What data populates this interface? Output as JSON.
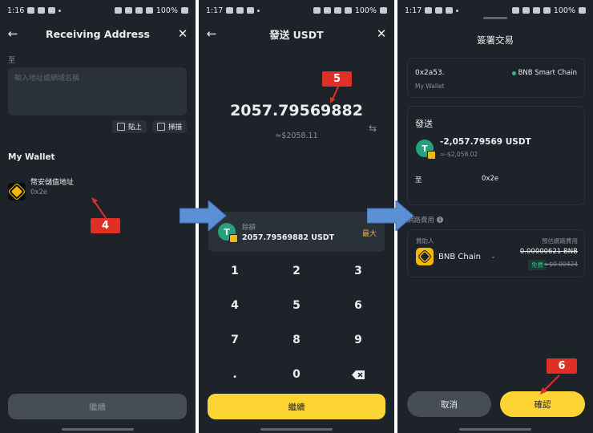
{
  "panel1": {
    "status": {
      "time": "1:16",
      "battery": "100%"
    },
    "title": "Receiving Address",
    "to_label": "至",
    "address_placeholder": "輸入地址或網域名稱",
    "paste_label": "貼上",
    "scan_label": "掃描",
    "wallet_section": "My Wallet",
    "wallet_item": {
      "name": "幣安儲值地址",
      "address": "0x2e"
    },
    "continue_label": "繼續",
    "step_label": "4"
  },
  "panel2": {
    "status": {
      "time": "1:17",
      "battery": "100%"
    },
    "title": "發送 USDT",
    "amount": "2057.79569882",
    "fiat": "≈$2058.11",
    "balance_label": "餘額",
    "balance_value": "2057.79569882 USDT",
    "max_label": "最大",
    "keys": [
      "1",
      "2",
      "3",
      "4",
      "5",
      "6",
      "7",
      "8",
      "9",
      ".",
      "0"
    ],
    "continue_label": "繼續",
    "step_label": "5"
  },
  "panel3": {
    "status": {
      "time": "1:17",
      "battery": "100%"
    },
    "title": "簽署交易",
    "from_address": "0x2a53.",
    "from_wallet": "My Wallet",
    "chain_tag": "BNB Smart Chain",
    "send_label": "發送",
    "send_amount": "-2,057.79569 USDT",
    "send_fiat": "≈-$2,058.02",
    "to_label": "至",
    "to_address": "0x2e",
    "fee_label": "網路費用",
    "sponsor_label": "贊助人",
    "est_fee_label": "預估網路費用",
    "sponsor_chain": "BNB Chain",
    "fee_amount": "0.00000621 BNB",
    "free_label": "免費",
    "fee_usd": "≈$0.00424",
    "cancel_label": "取消",
    "confirm_label": "確認",
    "step_label": "6"
  },
  "colors": {
    "bg": "#1e2329",
    "card": "#2b3139",
    "accent": "#fcd535",
    "callout": "#e02f26",
    "arrow": "#5b8fd6",
    "tether": "#26a17b"
  }
}
